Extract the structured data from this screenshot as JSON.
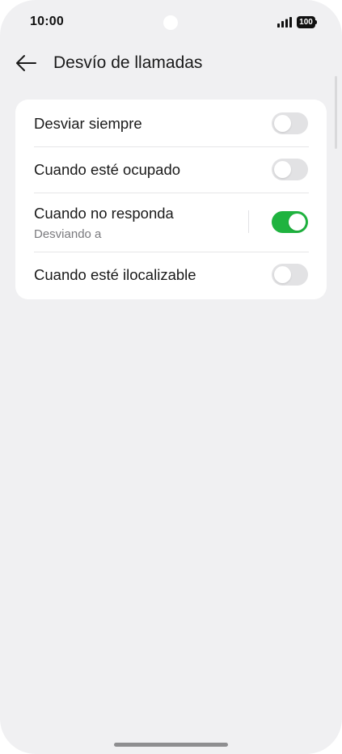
{
  "status_bar": {
    "time": "10:00",
    "battery": "100",
    "icons": [
      "signal-icon",
      "battery-icon"
    ]
  },
  "header": {
    "title": "Desvío de llamadas",
    "back_icon": "arrow-left-icon"
  },
  "forwarding_options": [
    {
      "label": "Desviar siempre",
      "sublabel": "",
      "enabled": false
    },
    {
      "label": "Cuando esté ocupado",
      "sublabel": "",
      "enabled": false
    },
    {
      "label": "Cuando no responda",
      "sublabel": "Desviando a",
      "enabled": true
    },
    {
      "label": "Cuando esté ilocalizable",
      "sublabel": "",
      "enabled": false
    }
  ],
  "colors": {
    "toggle_on": "#1fb33f",
    "toggle_off": "#e2e2e4",
    "background": "#f0f0f2",
    "card": "#ffffff"
  }
}
